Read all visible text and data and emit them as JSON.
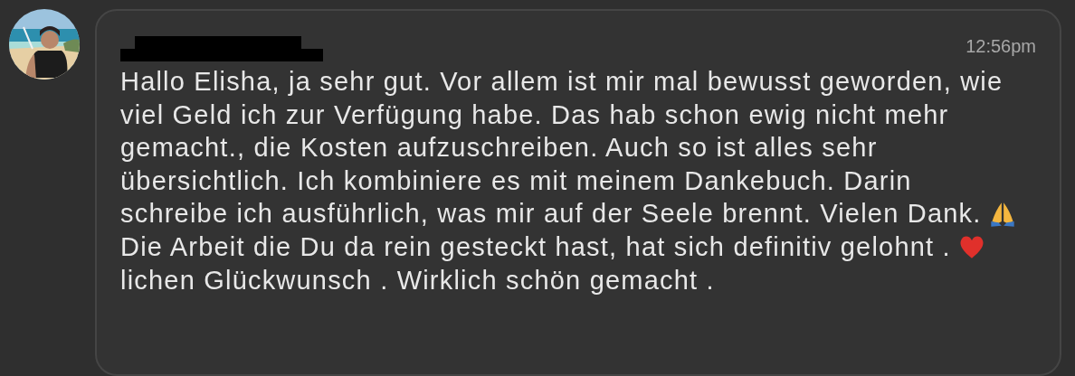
{
  "message": {
    "time": "12:56pm",
    "lines": [
      {
        "text": "Hallo Elisha, ja sehr gut. Vor allem ist mir mal bewusst geworden, wie"
      },
      {
        "text": "viel Geld ich zur Verfügung habe. Das hab schon ewig nicht mehr"
      },
      {
        "text": "gemacht., die Kosten aufzuschreiben. Auch so ist alles sehr"
      },
      {
        "text": "übersichtlich. Ich kombiniere es mit meinem Dankebuch. Darin"
      },
      {
        "text": "schreibe ich ausführlich, was mir auf der Seele brennt. Vielen Dank.",
        "icon": {
          "kind": "pray"
        }
      },
      {
        "text": "Die Arbeit die Du da rein gesteckt hast, hat sich definitiv gelohnt .",
        "icon": {
          "kind": "heart"
        }
      },
      {
        "text": "lichen Glückwunsch . Wirklich schön gemacht ."
      }
    ]
  }
}
